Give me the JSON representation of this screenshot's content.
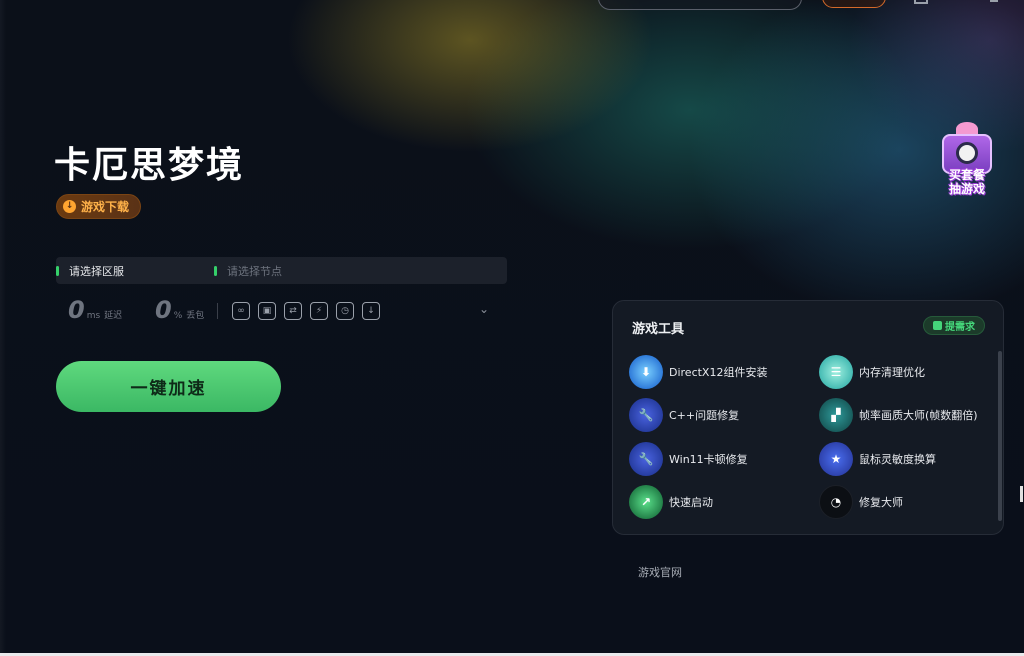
{
  "game": {
    "title": "卡厄思梦境",
    "download_label": "游戏下载"
  },
  "selectors": {
    "region_label": "请选择区服",
    "node_placeholder": "请选择节点"
  },
  "stats": {
    "latency_value": "0",
    "latency_unit": "ms",
    "latency_label": "延迟",
    "loss_value": "0",
    "loss_unit": "%",
    "loss_label": "丢包"
  },
  "quick_tools": [
    "link-icon",
    "screen-icon",
    "switch-icon",
    "lightning-icon",
    "timer-icon",
    "download-icon"
  ],
  "boost_button": "一键加速",
  "promo": {
    "line1": "买套餐",
    "line2": "抽游戏"
  },
  "tools_panel": {
    "title": "游戏工具",
    "request_label": "提需求",
    "items": [
      {
        "label": "DirectX12组件安装",
        "icon": "directx-icon"
      },
      {
        "label": "内存清理优化",
        "icon": "memory-clean-icon"
      },
      {
        "label": "C++问题修复",
        "icon": "wrench-icon"
      },
      {
        "label": "帧率画质大师(帧数翻倍)",
        "icon": "frame-rate-icon"
      },
      {
        "label": "Win11卡顿修复",
        "icon": "wrench-icon"
      },
      {
        "label": "鼠标灵敏度换算",
        "icon": "mouse-icon"
      },
      {
        "label": "快速启动",
        "icon": "launch-icon"
      },
      {
        "label": "修复大师",
        "icon": "repair-master-icon"
      }
    ]
  },
  "official_link": "游戏官网",
  "colors": {
    "accent_green": "#3bb864",
    "download_orange": "#ffb24a"
  }
}
